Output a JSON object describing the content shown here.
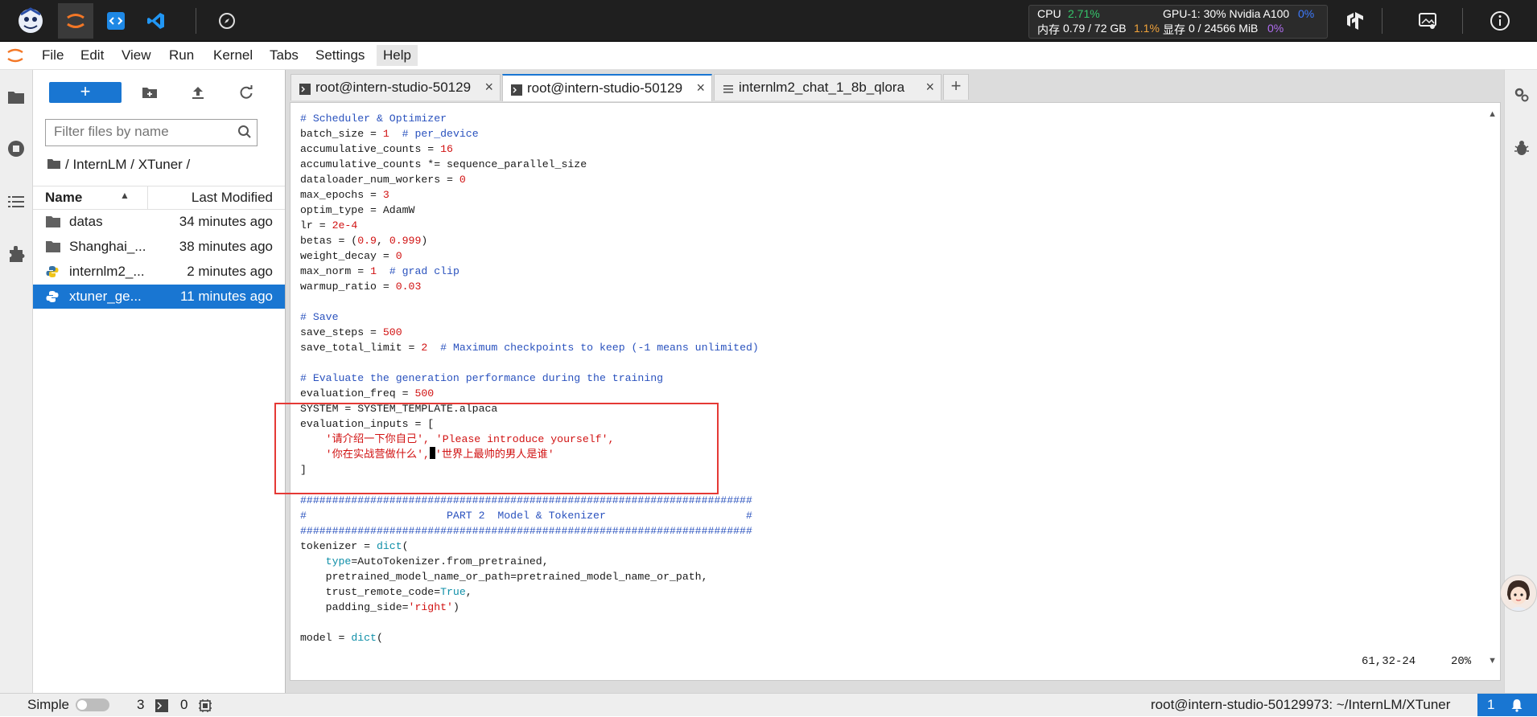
{
  "topbar": {
    "cpu_label": "CPU",
    "cpu_value": "2.71%",
    "mem_label": "内存",
    "mem_value": "0.79 / 72 GB",
    "mem_pct": "1.1%",
    "gpu_label": "GPU-1: 30% Nvidia A100",
    "gpu_value": "0%",
    "vram_label": "显存",
    "vram_value": "0 / 24566 MiB",
    "vram_pct": "0%"
  },
  "menubar": {
    "items": [
      "File",
      "Edit",
      "View",
      "Run",
      "Kernel",
      "Tabs",
      "Settings",
      "Help"
    ]
  },
  "filebrowser": {
    "new_label": "+",
    "filter_placeholder": "Filter files by name",
    "breadcrumb": "/ InternLM / XTuner /",
    "col_name": "Name",
    "col_modified": "Last Modified",
    "files": [
      {
        "name": "datas",
        "modified": "34 minutes ago",
        "icon": "folder-icon"
      },
      {
        "name": "Shanghai_...",
        "modified": "38 minutes ago",
        "icon": "folder-icon"
      },
      {
        "name": "internlm2_...",
        "modified": "2 minutes ago",
        "icon": "python-file-icon"
      },
      {
        "name": "xtuner_ge...",
        "modified": "11 minutes ago",
        "icon": "python-file-icon"
      }
    ]
  },
  "tabs": [
    {
      "label": "root@intern-studio-50129",
      "icon": "terminal-icon"
    },
    {
      "label": "root@intern-studio-50129",
      "icon": "terminal-icon"
    },
    {
      "label": "internlm2_chat_1_8b_qlora",
      "icon": "text-file-icon"
    }
  ],
  "terminal": {
    "lines": [
      "# Scheduler & Optimizer",
      "batch_size = 1  # per_device",
      "accumulative_counts = 16",
      "accumulative_counts *= sequence_parallel_size",
      "dataloader_num_workers = 0",
      "max_epochs = 3",
      "optim_type = AdamW",
      "lr = 2e-4",
      "betas = (0.9, 0.999)",
      "weight_decay = 0",
      "max_norm = 1  # grad clip",
      "warmup_ratio = 0.03",
      "",
      "# Save",
      "save_steps = 500",
      "save_total_limit = 2  # Maximum checkpoints to keep (-1 means unlimited)",
      "",
      "# Evaluate the generation performance during the training",
      "evaluation_freq = 500",
      "SYSTEM = SYSTEM_TEMPLATE.alpaca",
      "evaluation_inputs = [",
      "    '请介绍一下你自己', 'Please introduce yourself',",
      "    '你在实战营做什么', '世界上最帅的男人是谁'",
      "]",
      "",
      "#######################################################################",
      "#                      PART 2  Model & Tokenizer                      #",
      "#######################################################################",
      "tokenizer = dict(",
      "    type=AutoTokenizer.from_pretrained,",
      "    pretrained_model_name_or_path=pretrained_model_name_or_path,",
      "    trust_remote_code=True,",
      "    padding_side='right')",
      "",
      "model = dict("
    ],
    "cursor_pos": "61,32-24",
    "scroll_pct": "20%"
  },
  "statusbar": {
    "mode_label": "Simple",
    "kernels_count": "3",
    "terminals_count": "0",
    "path": "root@intern-studio-50129973: ~/InternLM/XTuner",
    "notifications": "1"
  }
}
